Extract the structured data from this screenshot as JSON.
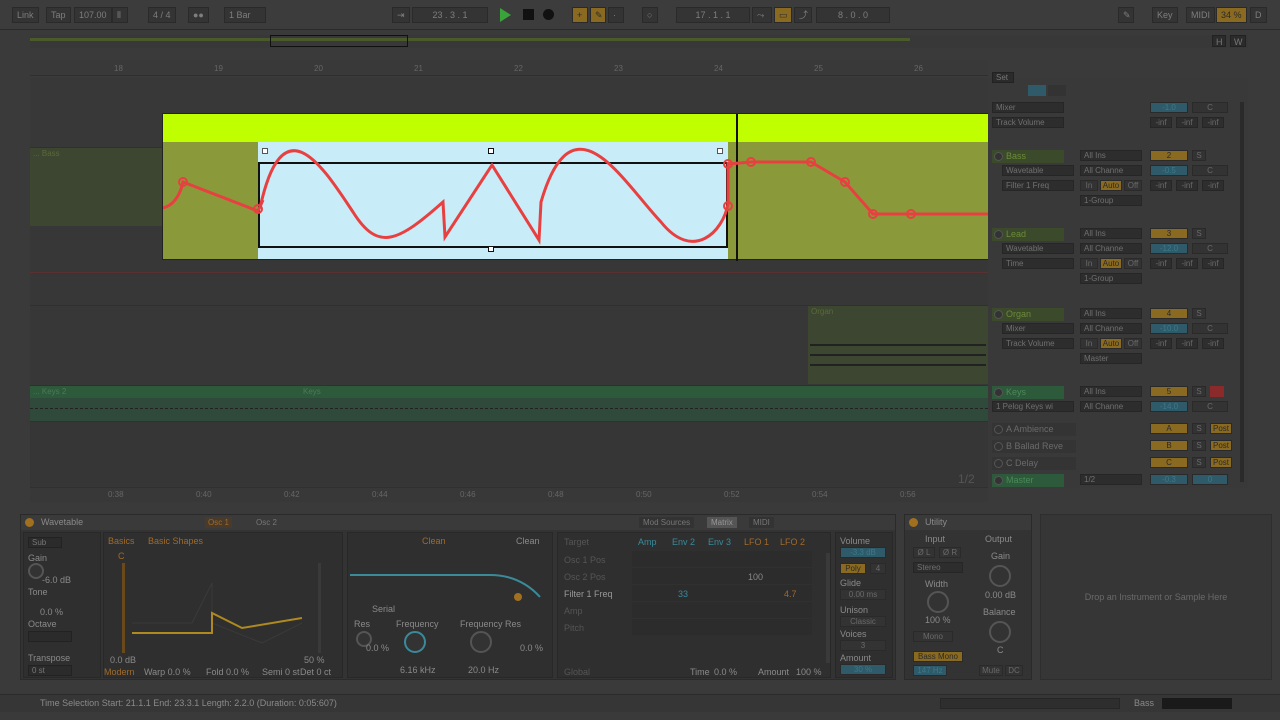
{
  "transport": {
    "link": "Link",
    "tap": "Tap",
    "tempo": "107.00",
    "meter": "4 / 4",
    "quantize": "1 Bar",
    "position": "23 .  3 .  1",
    "loop_start": "17 .  1 .  1",
    "loop_length": "8 .  0 .  0",
    "key": "Key",
    "midi": "MIDI",
    "cpu": "34 %",
    "d": "D"
  },
  "ruler": {
    "bars": [
      "18",
      "19",
      "20",
      "21",
      "22",
      "23",
      "24",
      "25",
      "26"
    ],
    "times": [
      "0:38",
      "0:40",
      "0:42",
      "0:44",
      "0:46",
      "0:48",
      "0:50",
      "0:52",
      "0:54",
      "0:56"
    ],
    "zoom": "1/2"
  },
  "overview_buttons": [
    "H",
    "W"
  ],
  "clips": {
    "bass": "... Bass",
    "organ": "Organ",
    "keys2": "... Keys 2",
    "keys": "Keys"
  },
  "mixer": {
    "set_label": "Set",
    "master_top": {
      "sel1": "Mixer",
      "sel2": "Track Volume",
      "vol": "-1.0",
      "pan": "C",
      "inf": [
        "-inf",
        "-inf",
        "-inf"
      ]
    },
    "tracks": [
      {
        "name": "Bass",
        "dev": "Wavetable",
        "param": "Filter 1 Freq",
        "input": "All Ins",
        "channel": "All Channe",
        "monitor": [
          "In",
          "Auto",
          "Off"
        ],
        "out": "1-Group",
        "num": "2",
        "s": "S",
        "vol": "-0.5",
        "pan": "C",
        "inf": [
          "-inf",
          "-inf",
          "-inf"
        ]
      },
      {
        "name": "Lead",
        "dev": "Wavetable",
        "param": "Time",
        "input": "All Ins",
        "channel": "All Channe",
        "monitor": [
          "In",
          "Auto",
          "Off"
        ],
        "out": "1-Group",
        "num": "3",
        "s": "S",
        "vol": "-12.0",
        "pan": "C",
        "inf": [
          "-inf",
          "-inf",
          "-inf"
        ]
      },
      {
        "name": "Organ",
        "dev": "Mixer",
        "param": "Track Volume",
        "input": "All Ins",
        "channel": "All Channe",
        "monitor": [
          "In",
          "Auto",
          "Off"
        ],
        "out": "Master",
        "num": "4",
        "s": "S",
        "vol": "-10.0",
        "pan": "C",
        "inf": [
          "-inf",
          "-inf",
          "-inf"
        ]
      },
      {
        "name": "Keys",
        "dev": "1 Pelog Keys wi",
        "input": "All Ins",
        "channel": "All Channe",
        "num": "5",
        "s": "S",
        "vol": "-14.0",
        "pan": "C"
      }
    ],
    "returns": [
      {
        "name": "A Ambience",
        "letter": "A",
        "s": "S",
        "post": "Post"
      },
      {
        "name": "B Ballad Reve",
        "letter": "B",
        "s": "S",
        "post": "Post"
      },
      {
        "name": "C Delay",
        "letter": "C",
        "s": "S",
        "post": "Post"
      }
    ],
    "master": {
      "name": "Master",
      "sel": "1/2",
      "vol": "-0.3",
      "pan": "0"
    }
  },
  "wavetable": {
    "title": "Wavetable",
    "osc_tabs": [
      "Osc 1",
      "Osc 2"
    ],
    "sub": "Sub",
    "gain_label": "Gain",
    "gain": "-6.0 dB",
    "tone_label": "Tone",
    "tone": "0.0 %",
    "octave_label": "Octave",
    "transpose_label": "Transpose",
    "transpose": "0 st",
    "category": "Basics",
    "table": "Basic Shapes",
    "osc_c": "C",
    "osc_db": "0.0 dB",
    "osc_pct": "50 %",
    "footer": [
      "Modern",
      "Warp 0.0 %",
      "Fold 0.0 %",
      "Semi 0 st",
      "Det 0 ct"
    ],
    "filter_type": "Clean",
    "filter_type2": "Clean",
    "routing": "Serial",
    "res_label": "Res",
    "res": "0.0 %",
    "freq_label": "Frequency",
    "freq": "6.16 kHz",
    "freq_res_label": "Frequency Res",
    "freq2": "20.0 Hz",
    "res2": "0.0 %",
    "mod_tabs": [
      "Mod Sources",
      "Matrix",
      "MIDI"
    ],
    "matrix_cols": [
      "Target",
      "Amp",
      "Env 2",
      "Env 3",
      "LFO 1",
      "LFO 2"
    ],
    "matrix_rows": [
      "Osc 1 Pos",
      "Osc 2 Pos",
      "Filter 1 Freq",
      "Amp",
      "Pitch"
    ],
    "matrix_vals": {
      "lfo1_osc2": "100",
      "env2_filter": "33",
      "lfo2_filter": "4.7"
    },
    "global": "Global",
    "time_label": "Time",
    "time": "0.0 %",
    "amount_label": "Amount",
    "amount": "100 %",
    "volume_label": "Volume",
    "volume": "-3.3 dB",
    "poly": "Poly",
    "poly_voices": "4",
    "glide_label": "Glide",
    "glide": "0.00 ms",
    "unison_label": "Unison",
    "unison": "Classic",
    "voices_label": "Voices",
    "voices": "3",
    "amount2_label": "Amount",
    "amount2": "30 %"
  },
  "utility": {
    "title": "Utility",
    "input": "Input",
    "output": "Output",
    "phase_l": "Ø L",
    "phase_r": "Ø R",
    "gain_label": "Gain",
    "stereo": "Stereo",
    "gain": "0.00 dB",
    "width_label": "Width",
    "width": "100 %",
    "balance_label": "Balance",
    "balance": "C",
    "mono": "Mono",
    "bass_mono": "Bass Mono",
    "bass_freq": "147 Hz",
    "mute": "Mute",
    "dc": "DC"
  },
  "dropzone": "Drop an Instrument or Sample Here",
  "status": {
    "selection": "Time Selection   Start: 21.1.1   End: 23.3.1   Length: 2.2.0   (Duration: 0:05:607)",
    "track": "Bass"
  },
  "colors": {
    "automation": "#e84040",
    "clip_top": "#c0ff00",
    "clip_green": "#8a9a3a",
    "selection": "#c8ecf8"
  },
  "automation_points_left": [
    [
      0.0,
      0.45
    ],
    [
      0.2,
      0.25
    ],
    [
      0.95,
      0.45
    ]
  ],
  "automation_points_right": [
    [
      0.0,
      0.1
    ],
    [
      0.06,
      0.1
    ],
    [
      0.3,
      0.1
    ],
    [
      0.4,
      0.3
    ],
    [
      0.5,
      0.58
    ],
    [
      0.65,
      0.58
    ],
    [
      1.0,
      0.58
    ]
  ]
}
